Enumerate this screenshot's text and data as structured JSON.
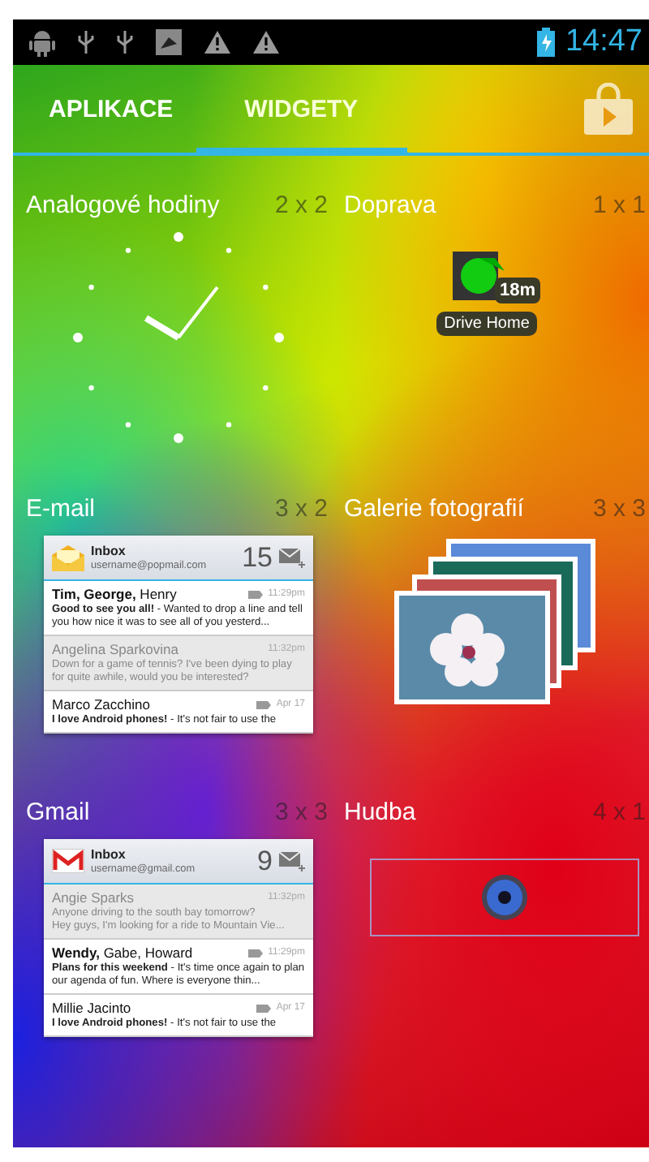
{
  "status_bar": {
    "time": "14:47"
  },
  "tabs": [
    {
      "label": "APLIKACE",
      "selected": false
    },
    {
      "label": "WIDGETY",
      "selected": true
    }
  ],
  "widgets": [
    {
      "kind": "clock",
      "name": "Analogové hodiny",
      "size": "2 x 2"
    },
    {
      "kind": "traffic",
      "name": "Doprava",
      "size": "1 x 1",
      "badge": "18m",
      "caption": "Drive Home"
    },
    {
      "kind": "mail",
      "name": "E-mail",
      "size": "3 x 2",
      "logo": {
        "kind": "envelope"
      },
      "inbox": "Inbox",
      "account": "username@popmail.com",
      "count": "15",
      "messages": [
        {
          "sender": "**Tim, George,** Henry",
          "time": "11:29pm",
          "lines": [
            "**Good to see you all!** - Wanted to drop a line and tell you how nice it was to see all of you yesterd..."
          ],
          "read": false
        },
        {
          "sender": "Angelina Sparkovina",
          "time": "11:32pm",
          "lines": [
            "Down for a game of tennis? I've been dying to play for quite awhile, would you be interested?"
          ],
          "read": true
        },
        {
          "sender": "Marco Zacchino",
          "time": "Apr 17",
          "lines": [
            "**I love Android phones!** - It's not fair to use the"
          ],
          "read": false
        }
      ]
    },
    {
      "kind": "gallery",
      "name": "Galerie fotografií",
      "size": "3 x 3"
    },
    {
      "kind": "mail",
      "name": "Gmail",
      "size": "3 x 3",
      "logo": {
        "kind": "gmail"
      },
      "inbox": "Inbox",
      "account": "username@gmail.com",
      "count": "9",
      "messages": [
        {
          "sender": "Angie Sparks",
          "time": "11:32pm",
          "lines": [
            "Anyone driving to the south bay tomorrow?",
            "Hey guys, I'm looking for a ride to Mountain Vie..."
          ],
          "read": true
        },
        {
          "sender": "**Wendy,** Gabe, Howard",
          "time": "11:29pm",
          "lines": [
            "**Plans for this weekend** - It's time once again to plan our agenda of fun. Where is everyone thin..."
          ],
          "read": false
        },
        {
          "sender": "Millie Jacinto",
          "time": "Apr 17",
          "lines": [
            "**I love Android phones!** - It's not fair to use the"
          ],
          "read": false
        }
      ]
    },
    {
      "kind": "music",
      "name": "Hudba",
      "size": "4 x 1"
    }
  ]
}
